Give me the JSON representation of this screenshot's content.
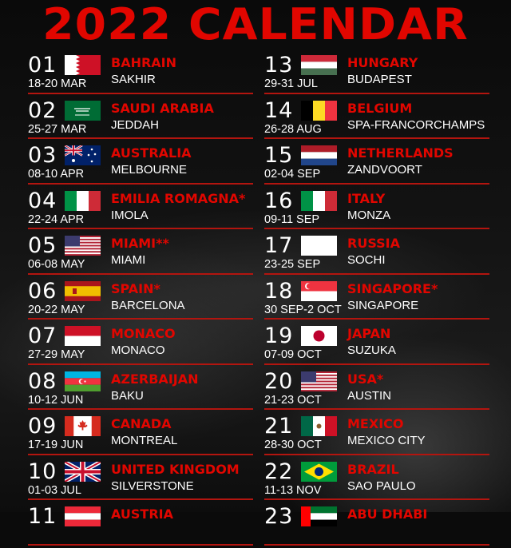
{
  "title": "2022 CALENDAR",
  "colors": {
    "accent": "#e10600",
    "background": "#0b0b0b",
    "divider": "#b3150f"
  },
  "left_column": [
    {
      "round": "01",
      "dates": "18-20 MAR",
      "country": "BAHRAIN",
      "city": "SAKHIR",
      "flag": "bahrain-flag-icon"
    },
    {
      "round": "02",
      "dates": "25-27 MAR",
      "country": "SAUDI ARABIA",
      "city": "JEDDAH",
      "flag": "saudi-arabia-flag-icon"
    },
    {
      "round": "03",
      "dates": "08-10 APR",
      "country": "AUSTRALIA",
      "city": "MELBOURNE",
      "flag": "australia-flag-icon"
    },
    {
      "round": "04",
      "dates": "22-24 APR",
      "country": "EMILIA ROMAGNA*",
      "city": "IMOLA",
      "flag": "italy-flag-icon"
    },
    {
      "round": "05",
      "dates": "06-08 MAY",
      "country": "MIAMI**",
      "city": "MIAMI",
      "flag": "usa-flag-icon"
    },
    {
      "round": "06",
      "dates": "20-22 MAY",
      "country": "SPAIN*",
      "city": "BARCELONA",
      "flag": "spain-flag-icon"
    },
    {
      "round": "07",
      "dates": "27-29 MAY",
      "country": "MONACO",
      "city": "MONACO",
      "flag": "monaco-flag-icon"
    },
    {
      "round": "08",
      "dates": "10-12 JUN",
      "country": "AZERBAIJAN",
      "city": "BAKU",
      "flag": "azerbaijan-flag-icon"
    },
    {
      "round": "09",
      "dates": "17-19 JUN",
      "country": "CANADA",
      "city": "MONTREAL",
      "flag": "canada-flag-icon"
    },
    {
      "round": "10",
      "dates": "01-03 JUL",
      "country": "UNITED KINGDOM",
      "city": "SILVERSTONE",
      "flag": "uk-flag-icon"
    },
    {
      "round": "11",
      "dates": "",
      "country": "AUSTRIA",
      "city": "",
      "flag": "austria-flag-icon"
    }
  ],
  "right_column": [
    {
      "round": "13",
      "dates": "29-31 JUL",
      "country": "HUNGARY",
      "city": "BUDAPEST",
      "flag": "hungary-flag-icon"
    },
    {
      "round": "14",
      "dates": "26-28 AUG",
      "country": "BELGIUM",
      "city": "SPA-FRANCORCHAMPS",
      "flag": "belgium-flag-icon"
    },
    {
      "round": "15",
      "dates": "02-04 SEP",
      "country": "NETHERLANDS",
      "city": "ZANDVOORT",
      "flag": "netherlands-flag-icon"
    },
    {
      "round": "16",
      "dates": "09-11 SEP",
      "country": "ITALY",
      "city": "MONZA",
      "flag": "italy-flag-icon"
    },
    {
      "round": "17",
      "dates": "23-25 SEP",
      "country": "RUSSIA",
      "city": "SOCHI",
      "flag": "blank-flag-icon"
    },
    {
      "round": "18",
      "dates": "30 SEP-2 OCT",
      "country": "SINGAPORE*",
      "city": "SINGAPORE",
      "flag": "singapore-flag-icon"
    },
    {
      "round": "19",
      "dates": "07-09 OCT",
      "country": "JAPAN",
      "city": "SUZUKA",
      "flag": "japan-flag-icon"
    },
    {
      "round": "20",
      "dates": "21-23 OCT",
      "country": "USA*",
      "city": "AUSTIN",
      "flag": "usa-flag-icon"
    },
    {
      "round": "21",
      "dates": "28-30 OCT",
      "country": "MEXICO",
      "city": "MEXICO CITY",
      "flag": "mexico-flag-icon"
    },
    {
      "round": "22",
      "dates": "11-13 NOV",
      "country": "BRAZIL",
      "city": "SAO PAULO",
      "flag": "brazil-flag-icon"
    },
    {
      "round": "23",
      "dates": "",
      "country": "ABU DHABI",
      "city": "",
      "flag": "uae-flag-icon"
    }
  ]
}
